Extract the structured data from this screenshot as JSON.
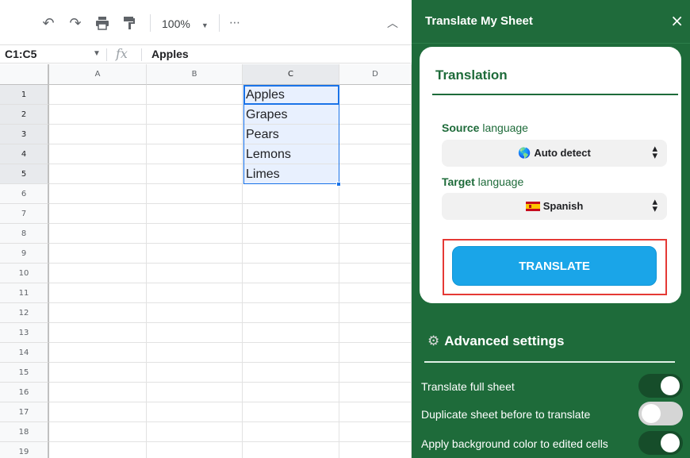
{
  "toolbar": {
    "undo_icon": "undo-icon",
    "redo_icon": "redo-icon",
    "print_icon": "print-icon",
    "paint_format_icon": "paint-format-icon",
    "zoom": "100%",
    "more_icon": "more-icon",
    "collapse_icon": "chevron-up-icon"
  },
  "formula_bar": {
    "name_box": "C1:C5",
    "fx": "fx",
    "value": "Apples"
  },
  "grid": {
    "columns": [
      "A",
      "B",
      "C",
      "D"
    ],
    "rows": [
      "1",
      "2",
      "3",
      "4",
      "5",
      "6",
      "7",
      "8",
      "9",
      "10",
      "11",
      "12",
      "13",
      "14",
      "15",
      "16",
      "17",
      "18",
      "19"
    ],
    "cells": {
      "C1": "Apples",
      "C2": "Grapes",
      "C3": "Pears",
      "C4": "Lemons",
      "C5": "Limes"
    },
    "selection": "C1:C5"
  },
  "sidebar": {
    "title": "Translate My Sheet",
    "close": "×",
    "card": {
      "title": "Translation",
      "source_label_bold": "Source",
      "source_label_rest": " language",
      "source_value": "Auto detect",
      "source_icon": "🌎",
      "target_label_bold": "Target",
      "target_label_rest": " language",
      "target_value": "Spanish",
      "target_icon": "spain-flag-icon",
      "translate_button": "TRANSLATE"
    },
    "advanced": {
      "title": "Advanced settings",
      "toggles": [
        {
          "label": "Translate full sheet",
          "on": true
        },
        {
          "label": "Duplicate sheet before to translate",
          "on": false
        },
        {
          "label": "Apply background color to edited cells",
          "on": true
        }
      ]
    },
    "colors": {
      "sidebar_bg": "#1e6b3a",
      "accent_green": "#1e6b3a",
      "button_blue": "#1aa5e8",
      "highlight_red": "#e53935",
      "selection_blue": "#1a73e8"
    }
  }
}
